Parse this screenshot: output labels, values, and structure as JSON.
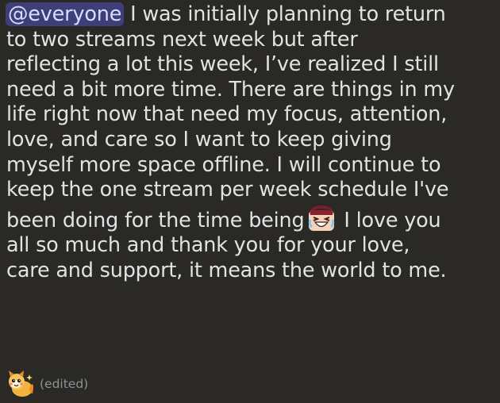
{
  "message": {
    "mention": "@everyone",
    "lines": [
      " I was initially planning to return",
      "to two streams next week but after",
      "reflecting a lot this week, I’ve realized I still",
      "need a bit more time. There are things in my",
      "life right now that need my focus, attention,",
      "love, and care so I want to keep giving",
      "myself more space offline. I will continue to",
      "keep the one stream per week schedule I've",
      "been doing for the time being",
      " I love you",
      "all so much and thank you for your love,",
      "care and support, it means the world to me."
    ],
    "edited_label": "(edited)"
  },
  "icons": {
    "inline_emoji": "crying-laughing-girl-emoji",
    "footer_emoji": "fox-character-emoji"
  },
  "colors": {
    "background": "#2b2925",
    "text": "#e2e2e4",
    "mention_bg": "#3e3f79",
    "mention_text": "#d8dcff",
    "muted": "#8e9096"
  }
}
